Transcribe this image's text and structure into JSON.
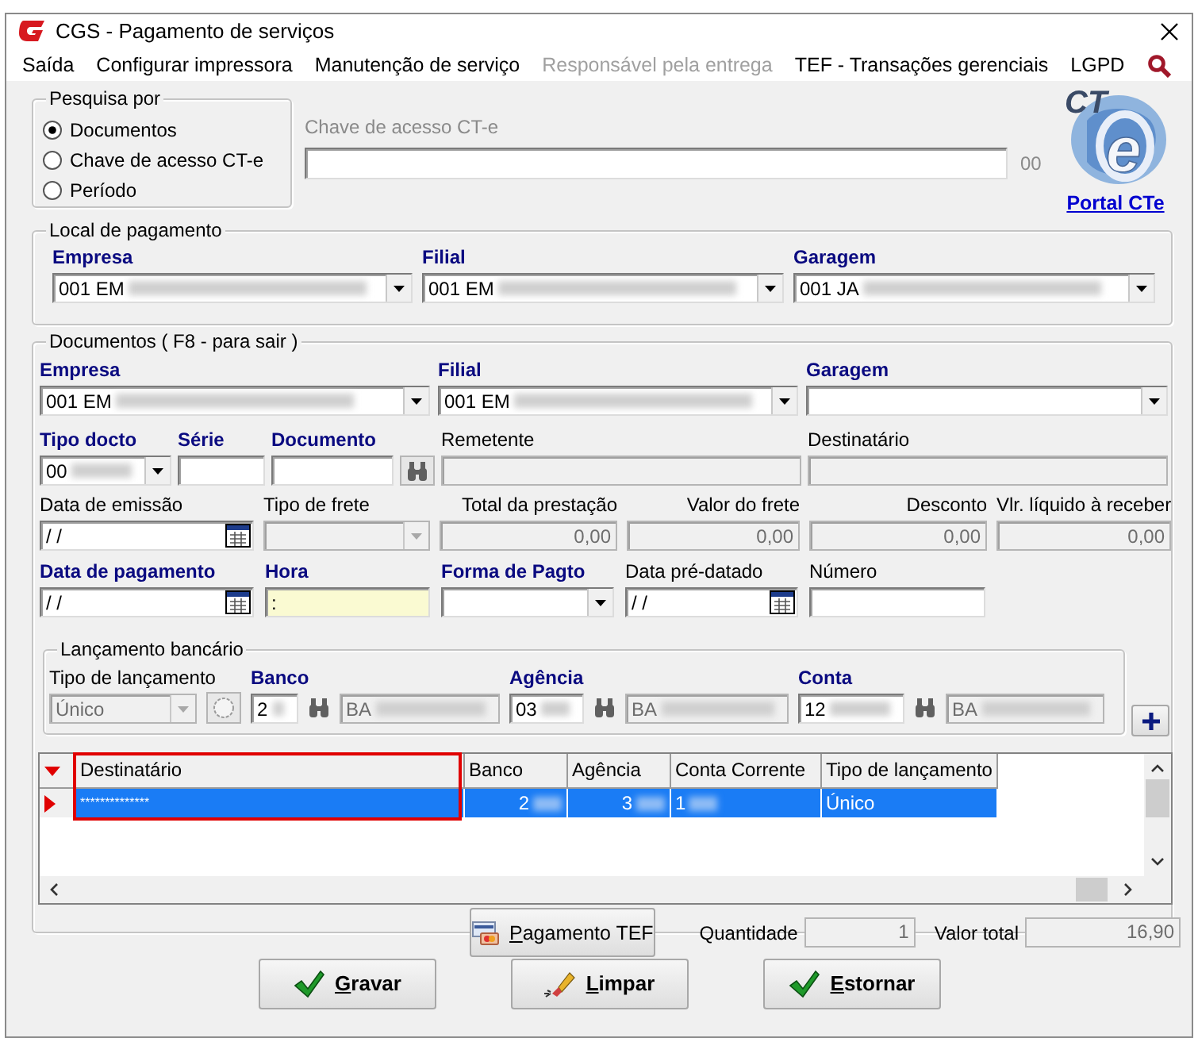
{
  "window": {
    "title": "CGS - Pagamento de serviços"
  },
  "menu": [
    {
      "label": "Saída",
      "disabled": false
    },
    {
      "label": "Configurar impressora",
      "disabled": false
    },
    {
      "label": "Manutenção de serviço",
      "disabled": false
    },
    {
      "label": "Responsável pela entrega",
      "disabled": true
    },
    {
      "label": "TEF - Transações gerenciais",
      "disabled": false
    },
    {
      "label": "LGPD",
      "disabled": false
    }
  ],
  "search_by": {
    "legend": "Pesquisa por",
    "options": [
      {
        "label": "Documentos",
        "selected": true
      },
      {
        "label": "Chave de acesso CT-e",
        "selected": false
      },
      {
        "label": "Período",
        "selected": false
      }
    ]
  },
  "access_key": {
    "label": "Chave de acesso CT-e",
    "suffix": "00"
  },
  "logo": {
    "text": "CT",
    "mark": "e"
  },
  "portal_link": "Portal CTe",
  "payment_location": {
    "legend": "Local de pagamento",
    "fields": [
      {
        "kind": "combo",
        "label": "Empresa",
        "strong": true,
        "value": "001 EM",
        "redacted": true
      },
      {
        "kind": "combo",
        "label": "Filial",
        "strong": true,
        "value": "001 EM",
        "redacted": true
      },
      {
        "kind": "combo",
        "label": "Garagem",
        "strong": true,
        "value": "001 JA",
        "redacted": true
      }
    ]
  },
  "documents": {
    "legend": "Documentos ( F8 - para sair )",
    "lines": [
      {
        "fields": [
          {
            "kind": "combo",
            "label": "Empresa",
            "strong": true,
            "value": "001 EM",
            "redacted": true
          },
          {
            "kind": "combo",
            "label": "Filial",
            "strong": true,
            "value": "001 EM",
            "redacted": true
          },
          {
            "kind": "combo",
            "label": "Garagem",
            "strong": true
          }
        ]
      },
      {
        "fields": [
          {
            "kind": "combo",
            "label": "Tipo docto",
            "strong": true,
            "value": "00",
            "redacted": true
          },
          {
            "kind": "text",
            "label": "Série",
            "strong": true
          },
          {
            "kind": "text",
            "label": "Documento",
            "strong": true
          },
          {
            "kind": "lookup"
          },
          {
            "kind": "text",
            "label": "Remetente",
            "strong": false,
            "disabled": true
          },
          {
            "kind": "text",
            "label": "Destinatário",
            "strong": false,
            "disabled": true
          }
        ]
      },
      {
        "fields": [
          {
            "kind": "date",
            "label": "Data de emissão",
            "strong": false,
            "value": "/ /"
          },
          {
            "kind": "combo",
            "label": "Tipo de frete",
            "strong": false,
            "disabled": true
          },
          {
            "kind": "amount",
            "label": "Total da prestação",
            "strong": false,
            "value": "0,00",
            "disabled": true
          },
          {
            "kind": "amount",
            "label": "Valor do frete",
            "strong": false,
            "value": "0,00",
            "disabled": true
          },
          {
            "kind": "amount",
            "label": "Desconto",
            "strong": false,
            "value": "0,00",
            "disabled": true
          },
          {
            "kind": "amount",
            "label": "Vlr. líquido à receber",
            "strong": false,
            "value": "0,00",
            "disabled": true
          }
        ]
      },
      {
        "fields": [
          {
            "kind": "date",
            "label": "Data de pagamento",
            "strong": true,
            "value": "/ /"
          },
          {
            "kind": "time",
            "label": "Hora",
            "strong": true,
            "value": ":"
          },
          {
            "kind": "combo",
            "label": "Forma de Pagto",
            "strong": true
          },
          {
            "kind": "date",
            "label": "Data pré-datado",
            "strong": false,
            "value": "/ /"
          },
          {
            "kind": "text",
            "label": "Número",
            "strong": false
          }
        ]
      }
    ],
    "bank": {
      "legend": "Lançamento bancário",
      "fields": [
        {
          "kind": "combo",
          "label": "Tipo de lançamento",
          "strong": false,
          "value": "Único",
          "disabled": true
        },
        {
          "kind": "round-button"
        },
        {
          "kind": "text",
          "label": "Banco",
          "strong": true,
          "value": "2",
          "redacted": true
        },
        {
          "kind": "lookup-icon"
        },
        {
          "kind": "text",
          "value": "BA",
          "redacted": true,
          "disabled": true
        },
        {
          "kind": "text",
          "label": "Agência",
          "strong": true,
          "value": "03",
          "redacted": true
        },
        {
          "kind": "lookup-icon"
        },
        {
          "kind": "text",
          "value": "BA",
          "redacted": true,
          "disabled": true
        },
        {
          "kind": "text",
          "label": "Conta",
          "strong": true,
          "value": "12",
          "redacted": true
        },
        {
          "kind": "lookup-icon"
        },
        {
          "kind": "text",
          "value": "BA",
          "redacted": true,
          "disabled": true
        }
      ]
    },
    "grid": {
      "columns": [
        {
          "label": "Destinatário",
          "highlighted": true
        },
        {
          "label": "Banco",
          "highlighted": false
        },
        {
          "label": "Agência",
          "highlighted": false
        },
        {
          "label": "Conta Corrente",
          "highlighted": false
        },
        {
          "label": "Tipo de lançamento",
          "highlighted": false
        }
      ],
      "rows": [
        {
          "selected": true,
          "cells": [
            {
              "text": "**************",
              "redacted": false
            },
            {
              "text": "2",
              "redacted": true
            },
            {
              "text": "3",
              "redacted": true
            },
            {
              "text": "1",
              "redacted": true
            },
            {
              "text": "Único",
              "redacted": false
            }
          ]
        }
      ]
    },
    "tef_button": "Pagamento TEF",
    "quantity": {
      "label": "Quantidade",
      "value": "1"
    },
    "total": {
      "label": "Valor total",
      "value": "16,90"
    }
  },
  "actions": [
    {
      "label": "Gravar",
      "kind": "check"
    },
    {
      "label": "Limpar",
      "kind": "eraser"
    },
    {
      "label": "Estornar",
      "kind": "check"
    }
  ]
}
